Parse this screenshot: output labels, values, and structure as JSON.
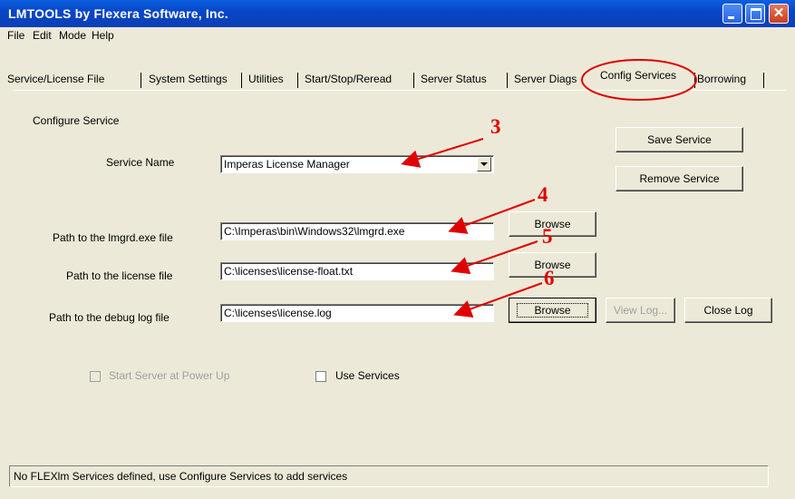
{
  "window": {
    "title": "LMTOOLS by Flexera Software, Inc."
  },
  "menu": [
    "File",
    "Edit",
    "Mode",
    "Help"
  ],
  "tabs": [
    "Service/License File",
    "System Settings",
    "Utilities",
    "Start/Stop/Reread",
    "Server Status",
    "Server Diags",
    "Config Services",
    "Borrowing"
  ],
  "active_tab": "Config Services",
  "config": {
    "section_title": "Configure Service",
    "service_name_label": "Service Name",
    "service_name_value": "Imperas License Manager",
    "lmgrd_label": "Path to the lmgrd.exe file",
    "lmgrd_value": "C:\\Imperas\\bin\\Windows32\\lmgrd.exe",
    "license_label": "Path to the license file",
    "license_value": "C:\\licenses\\license-float.txt",
    "debug_label": "Path to the debug log file",
    "debug_value": "C:\\licenses\\license.log",
    "save_service": "Save Service",
    "remove_service": "Remove Service",
    "browse": "Browse",
    "view_log": "View Log...",
    "close_log": "Close Log",
    "start_at_power_up": "Start Server at Power Up",
    "use_services": "Use Services"
  },
  "status": "No FLEXlm Services defined, use Configure Services to add services",
  "annotations": [
    "3",
    "4",
    "5",
    "6"
  ],
  "colors": {
    "annotation": "#e00000",
    "titlebar": "#0a4fd0"
  }
}
